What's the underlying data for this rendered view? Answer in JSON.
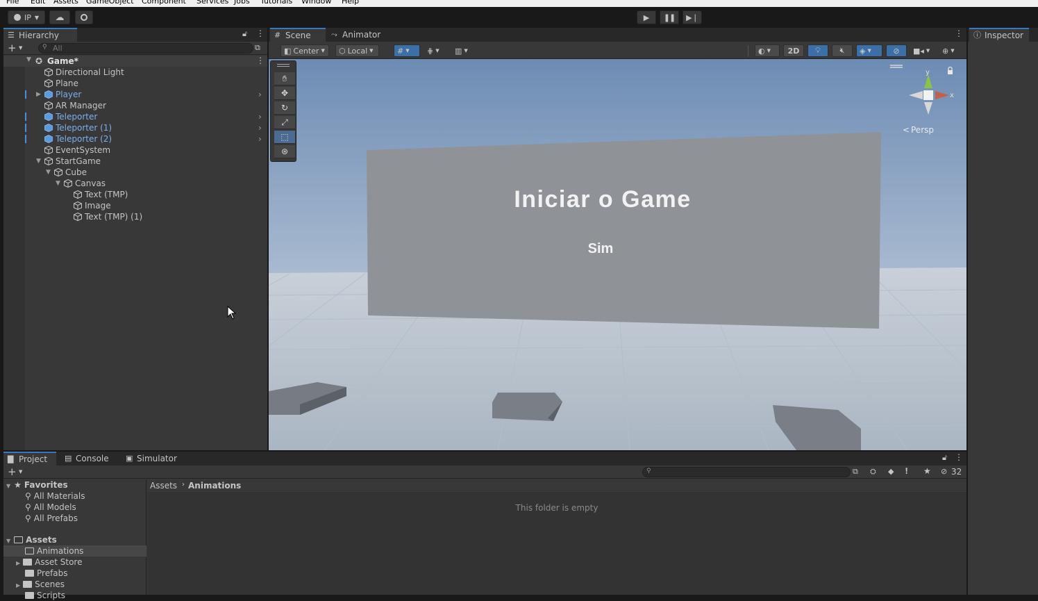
{
  "menubar": {
    "items": [
      "File",
      "Edit",
      "Assets",
      "GameObject",
      "Component",
      "Services",
      "Jobs",
      "Tutorials",
      "Window",
      "Help"
    ]
  },
  "toolbar": {
    "account_label": "IP"
  },
  "hierarchy": {
    "tab_label": "Hierarchy",
    "search_placeholder": "All",
    "scene_name": "Game*",
    "items": [
      {
        "label": "Directional Light",
        "indent": 0,
        "blue": false,
        "fold": "",
        "arrow": false
      },
      {
        "label": "Plane",
        "indent": 0,
        "blue": false,
        "fold": "",
        "arrow": false
      },
      {
        "label": "Player",
        "indent": 0,
        "blue": true,
        "fold": "closed",
        "arrow": true
      },
      {
        "label": "AR Manager",
        "indent": 0,
        "blue": false,
        "fold": "",
        "arrow": false
      },
      {
        "label": "Teleporter",
        "indent": 0,
        "blue": true,
        "fold": "",
        "arrow": true
      },
      {
        "label": "Teleporter (1)",
        "indent": 0,
        "blue": true,
        "fold": "",
        "arrow": true
      },
      {
        "label": "Teleporter (2)",
        "indent": 0,
        "blue": true,
        "fold": "",
        "arrow": true
      },
      {
        "label": "EventSystem",
        "indent": 0,
        "blue": false,
        "fold": "",
        "arrow": false
      },
      {
        "label": "StartGame",
        "indent": 0,
        "blue": false,
        "fold": "open",
        "arrow": false
      },
      {
        "label": "Cube",
        "indent": 1,
        "blue": false,
        "fold": "open",
        "arrow": false
      },
      {
        "label": "Canvas",
        "indent": 2,
        "blue": false,
        "fold": "open",
        "arrow": false
      },
      {
        "label": "Text (TMP)",
        "indent": 3,
        "blue": false,
        "fold": "",
        "arrow": false
      },
      {
        "label": "Image",
        "indent": 3,
        "blue": false,
        "fold": "",
        "arrow": false
      },
      {
        "label": "Text (TMP) (1)",
        "indent": 3,
        "blue": false,
        "fold": "",
        "arrow": false
      }
    ]
  },
  "scene": {
    "tabs": {
      "scene": "Scene",
      "animator": "Animator"
    },
    "pivot_label": "Center",
    "space_label": "Local",
    "mode_2d": "2D",
    "gizmo_axis_y": "y",
    "gizmo_axis_x": "x",
    "projection_label": "Persp",
    "board_title": "Iniciar o Game",
    "board_option": "Sim"
  },
  "inspector": {
    "tab_label": "Inspector"
  },
  "project": {
    "tabs": {
      "project": "Project",
      "console": "Console",
      "simulator": "Simulator"
    },
    "hidden_count": "32",
    "favorites_label": "Favorites",
    "favorites": [
      "All Materials",
      "All Models",
      "All Prefabs"
    ],
    "assets_label": "Assets",
    "folders": [
      "Animations",
      "Asset Store",
      "Prefabs",
      "Scenes",
      "Scripts"
    ],
    "breadcrumb": {
      "root": "Assets",
      "current": "Animations"
    },
    "empty_message": "This folder is empty"
  },
  "colors": {
    "accent": "#3a79bb",
    "selected_text": "#7bafe8",
    "panel": "#383838"
  }
}
